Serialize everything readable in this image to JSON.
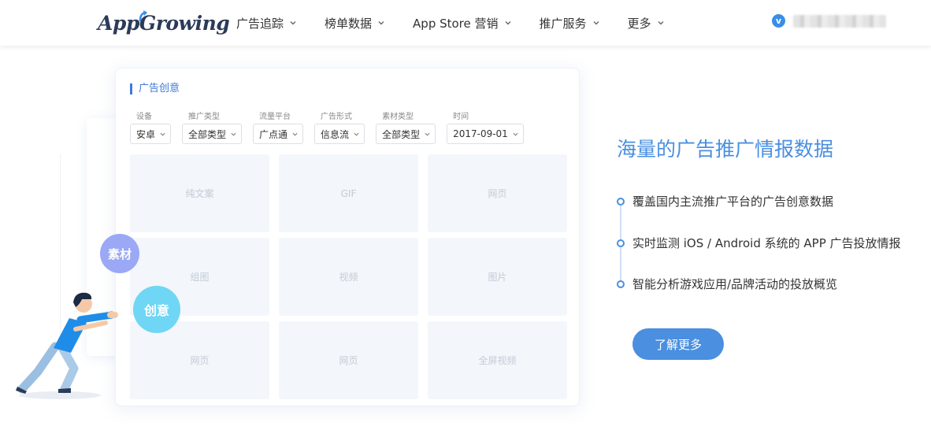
{
  "header": {
    "logo": {
      "part1": "App",
      "part2": "Growing"
    },
    "nav": [
      {
        "label": "广告追踪"
      },
      {
        "label": "榜单数据"
      },
      {
        "label": "App Store 营销"
      },
      {
        "label": "推广服务"
      },
      {
        "label": "更多"
      }
    ],
    "user": {
      "badge": "v"
    }
  },
  "card": {
    "title": "广告创意",
    "filters": [
      {
        "label": "设备",
        "value": "安卓"
      },
      {
        "label": "推广类型",
        "value": "全部类型"
      },
      {
        "label": "流量平台",
        "value": "广点通"
      },
      {
        "label": "广告形式",
        "value": "信息流"
      },
      {
        "label": "素材类型",
        "value": "全部类型"
      },
      {
        "label": "时间",
        "value": "2017-09-01"
      }
    ],
    "tiles": [
      "纯文案",
      "GIF",
      "网页",
      "组图",
      "视频",
      "图片",
      "网页",
      "网页",
      "全屏视频"
    ]
  },
  "circles": {
    "material": "素材",
    "creative": "创意"
  },
  "main": {
    "headline": "海量的广告推广情报数据",
    "features": [
      "覆盖国内主流推广平台的广告创意数据",
      "实时监测 iOS / Android 系统的 APP 广告投放情报",
      "智能分析游戏应用/品牌活动的投放概览"
    ],
    "cta_label": "了解更多"
  },
  "colors": {
    "accent": "#4a8fe0",
    "brand_dark": "#2b3b58",
    "tile_bg": "#f3f6fa"
  }
}
